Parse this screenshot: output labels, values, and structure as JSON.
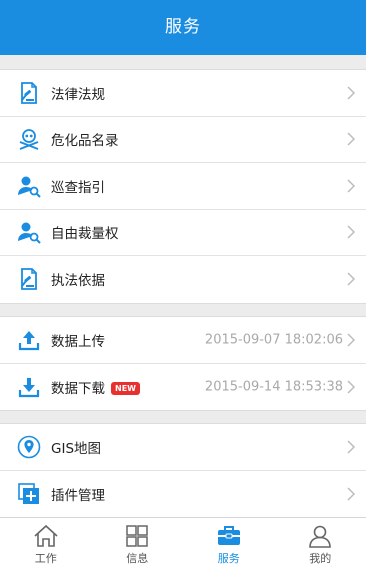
{
  "header": {
    "title": "服务"
  },
  "sections": [
    {
      "items": [
        {
          "label": "法律法规",
          "icon": "law-book-icon"
        },
        {
          "label": "危化品名录",
          "icon": "skull-crossbones-icon"
        },
        {
          "label": "巡查指引",
          "icon": "user-search-icon"
        },
        {
          "label": "自由裁量权",
          "icon": "user-search-icon"
        },
        {
          "label": "执法依据",
          "icon": "law-book-icon"
        }
      ]
    },
    {
      "items": [
        {
          "label": "数据上传",
          "icon": "upload-icon",
          "timestamp": "2015-09-07 18:02:06"
        },
        {
          "label": "数据下载",
          "icon": "download-icon",
          "badge": "NEW",
          "timestamp": "2015-09-14 18:53:38"
        }
      ]
    },
    {
      "items": [
        {
          "label": "GIS地图",
          "icon": "map-pin-icon"
        },
        {
          "label": "插件管理",
          "icon": "plugin-add-icon"
        }
      ]
    }
  ],
  "tabbar": {
    "tabs": [
      {
        "label": "工作",
        "icon": "home-icon",
        "active": false
      },
      {
        "label": "信息",
        "icon": "grid-icon",
        "active": false
      },
      {
        "label": "服务",
        "icon": "toolbox-icon",
        "active": true
      },
      {
        "label": "我的",
        "icon": "person-icon",
        "active": false
      }
    ]
  },
  "colors": {
    "accent": "#1a8de0",
    "badge": "#e8312f",
    "timestamp": "#a9a9a9"
  }
}
